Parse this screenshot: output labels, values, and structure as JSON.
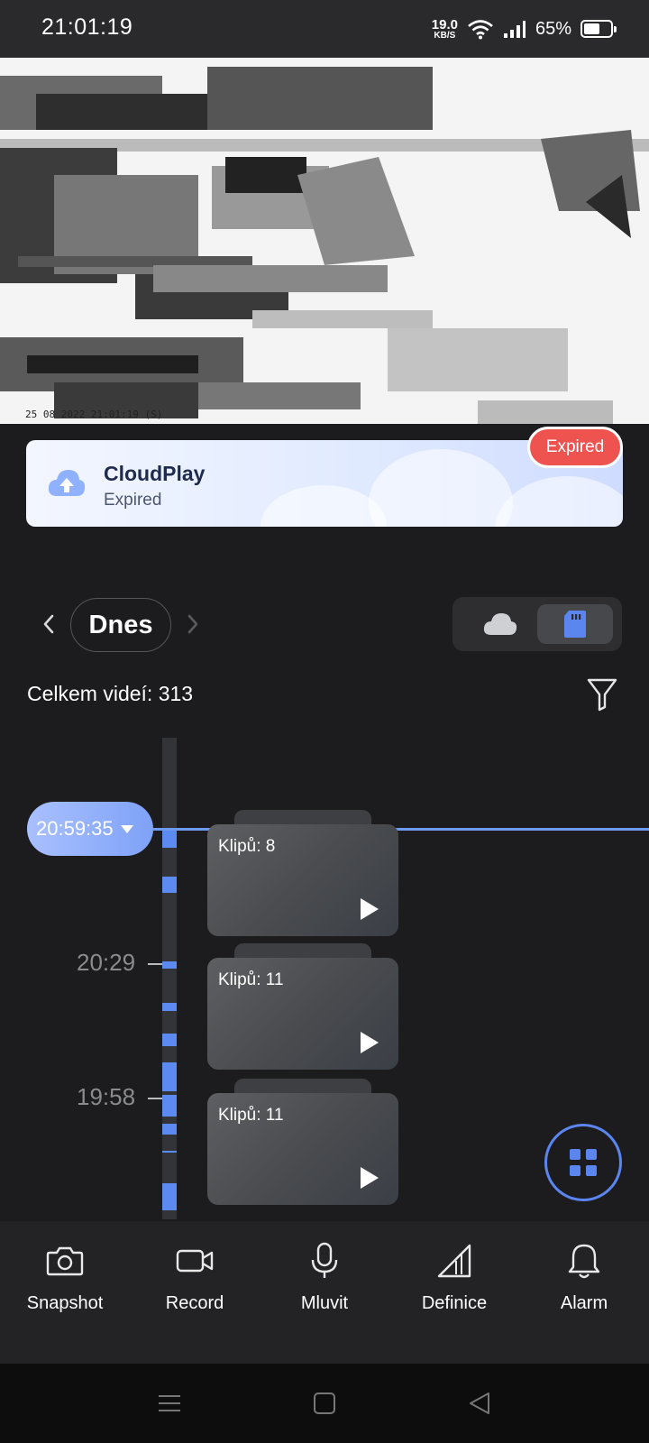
{
  "status_bar": {
    "time": "21:01:19",
    "net_speed_value": "19.0",
    "net_speed_unit": "KB/S",
    "battery_percent": "65%",
    "battery_level": 0.65
  },
  "video": {
    "timestamp": "25 08 2022 21:01:19 (S)"
  },
  "cloud_banner": {
    "title": "CloudPlay",
    "subtitle": "Expired",
    "badge": "Expired"
  },
  "date_nav": {
    "label": "Dnes",
    "prev_icon": "chevron-left-icon",
    "next_icon": "chevron-right-icon"
  },
  "source_toggle": {
    "options": [
      "cloud-icon",
      "sd-card-icon"
    ],
    "selected": "sd-card-icon",
    "accent": "#5b86f0"
  },
  "summary": {
    "total_label": "Celkem videí: 313"
  },
  "timeline": {
    "current_time": "20:59:35",
    "labels": [
      "20:29",
      "19:58"
    ]
  },
  "clips": [
    {
      "label": "Klipů: 8"
    },
    {
      "label": "Klipů: 11"
    },
    {
      "label": "Klipů: 11"
    }
  ],
  "toolbar": {
    "items": [
      {
        "label": "Snapshot",
        "icon": "camera-icon"
      },
      {
        "label": "Record",
        "icon": "video-camera-icon"
      },
      {
        "label": "Mluvit",
        "icon": "microphone-icon"
      },
      {
        "label": "Definice",
        "icon": "definition-icon"
      },
      {
        "label": "Alarm",
        "icon": "bell-icon"
      }
    ]
  },
  "colors": {
    "background": "#1c1c1e",
    "accent": "#5b86f0",
    "expired": "#ef5350"
  }
}
